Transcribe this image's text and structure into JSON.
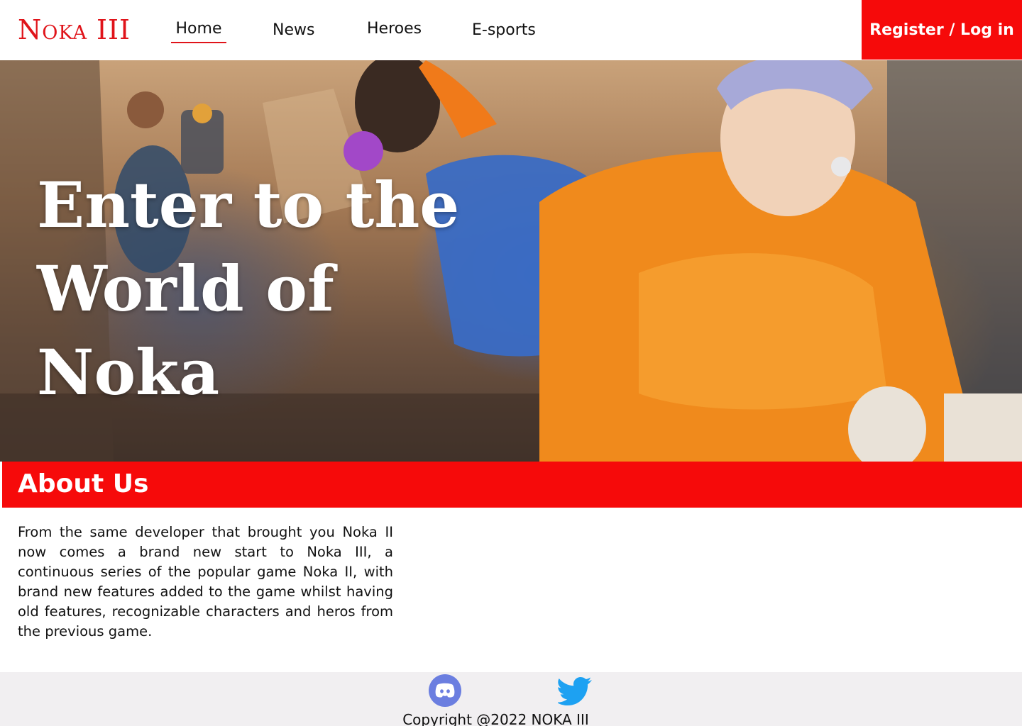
{
  "header": {
    "logo": "Noka III",
    "nav": {
      "home": "Home",
      "news": "News",
      "heroes": "Heroes",
      "esports": "E-sports"
    },
    "register_label": "Register / Log in",
    "active_tab": "Home"
  },
  "hero": {
    "title_line1": "Enter to the",
    "title_line2": "World of Noka"
  },
  "about": {
    "title": "About Us",
    "text": "From the same developer that brought you Noka II now comes a brand new start to Noka III, a continuous series of the popular game Noka II, with brand new features added to the game whilst having old features, recognizable characters and heros from the previous game."
  },
  "footer": {
    "icons": [
      "discord-icon",
      "twitter-icon"
    ],
    "copyright": "Copyright @2022 NOKA III"
  },
  "colors": {
    "accent": "#f60a0a",
    "logo": "#e0141a",
    "footer_bg": "#f1eff1",
    "discord": "#6b7ee0",
    "twitter": "#1da1f2"
  }
}
